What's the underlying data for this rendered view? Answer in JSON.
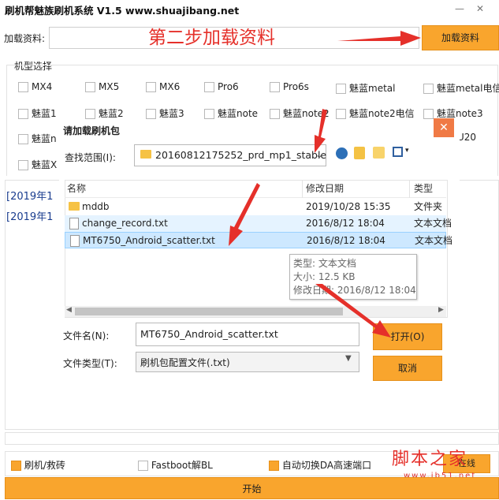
{
  "window": {
    "title": "刷机帮魅族刷机系统 V1.5 www.shuajibang.net",
    "minimize_glyph": "—",
    "close_glyph": "✕"
  },
  "load": {
    "label": "加载资料:",
    "value": "",
    "button": "加载资料"
  },
  "annotations": {
    "step2": "第二步加载资料"
  },
  "models": {
    "group_label": "机型选择",
    "row1": [
      "MX4",
      "MX5",
      "MX6",
      "Pro6",
      "Pro6s",
      "魅蓝metal",
      "魅蓝metal电信"
    ],
    "row2": [
      "魅蓝1",
      "魅蓝2",
      "魅蓝3",
      "魅蓝note",
      "魅蓝note2",
      "魅蓝note2电信",
      "魅蓝note3"
    ],
    "row3_left": "魅蓝n",
    "row3_right": "U20",
    "row4_left": "魅蓝X"
  },
  "log": [
    "[2019年1",
    "[2019年1"
  ],
  "dialog": {
    "title": "请加载刷机包",
    "close_glyph": "✕",
    "lookin_label": "查找范围(I):",
    "lookin_value": "20160812175252_prd_mp1_stable",
    "columns": {
      "name": "名称",
      "date": "修改日期",
      "type": "类型"
    },
    "files": [
      {
        "name": "mddb",
        "date": "2019/10/28 15:35",
        "type": "文件夹"
      },
      {
        "name": "change_record.txt",
        "date": "2016/8/12 18:04",
        "type": "文本文档"
      },
      {
        "name": "MT6750_Android_scatter.txt",
        "date": "2016/8/12 18:04",
        "type": "文本文档"
      }
    ],
    "tooltip": {
      "type_line": "类型: 文本文档",
      "size_line": "大小: 12.5 KB",
      "date_line": "修改日期: 2016/8/12 18:04"
    },
    "filename_label": "文件名(N):",
    "filename_value": "MT6750_Android_scatter.txt",
    "filetype_label": "文件类型(T):",
    "filetype_value": "刷机包配置文件(.txt)",
    "open_button": "打开(O)",
    "cancel_button": "取消"
  },
  "options": {
    "flash": "刷机/救砖",
    "fastboot": "Fastboot解BL",
    "auto_da": "自动切换DA高速端口",
    "partial": "在线"
  },
  "start_button": "开始",
  "watermark": {
    "main": "脚本之家",
    "url": "www.jb51.net"
  },
  "colors": {
    "accent": "#f9a52d",
    "annotation": "#e5302a",
    "selection": "#cde8ff"
  }
}
